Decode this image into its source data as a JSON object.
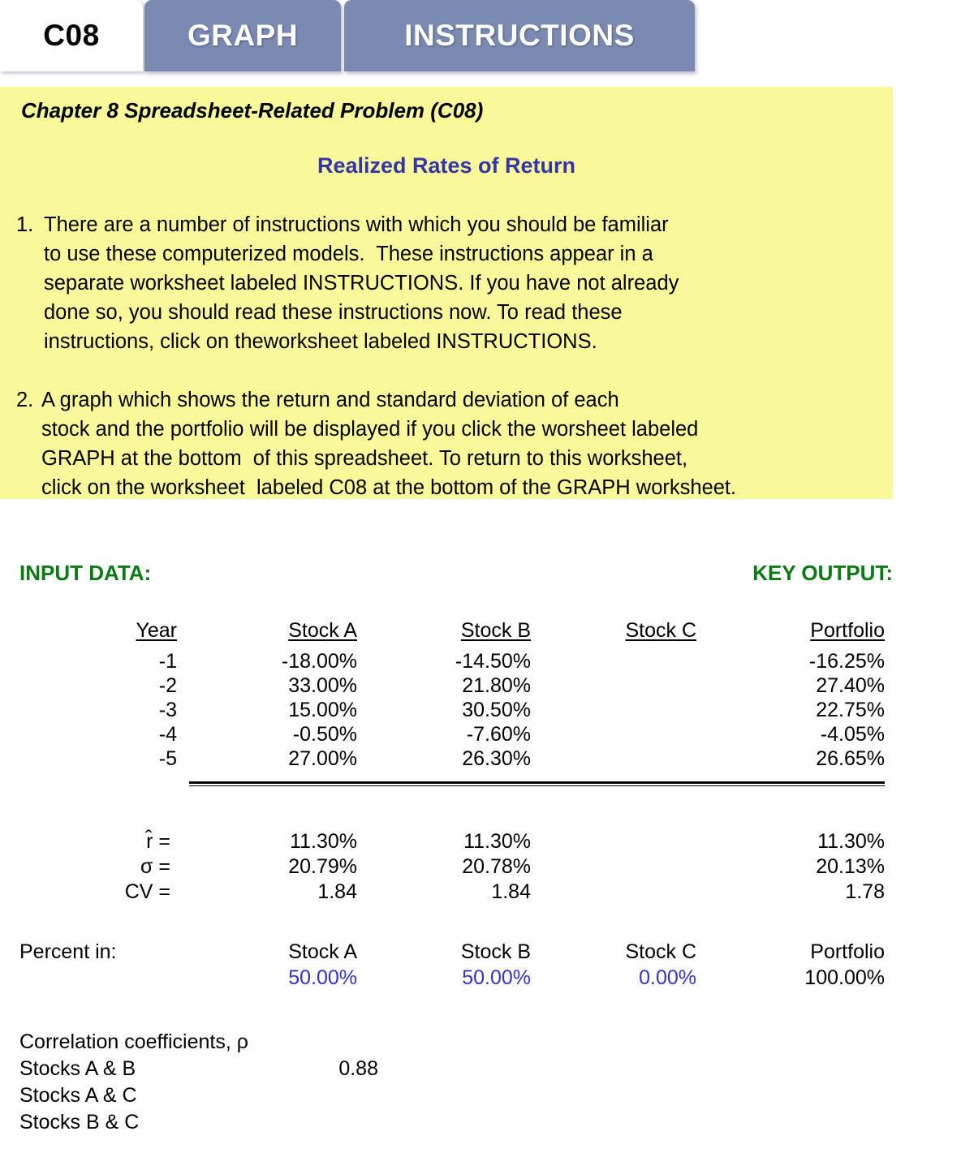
{
  "tabs": [
    {
      "label": "C08",
      "active": true
    },
    {
      "label": "GRAPH",
      "active": false
    },
    {
      "label": "INSTRUCTIONS",
      "active": false
    }
  ],
  "panel": {
    "title": "Chapter 8 Spreadsheet-Related Problem  (C08)",
    "subtitle": "Realized Rates of Return",
    "subtitle_color": "#3434ab",
    "background_color": "#f9f99a",
    "paragraphs": [
      {
        "number": "1.",
        "lines": [
          "There are a number of instructions with which you should be familiar",
          "to use these computerized models.  These instructions appear in a",
          "separate worksheet labeled INSTRUCTIONS. If you have not already",
          "done so, you should read these instructions now. To read these",
          "instructions, click on theworksheet labeled INSTRUCTIONS."
        ]
      },
      {
        "number": "2.",
        "lines": [
          "A graph which shows the return and standard deviation of each",
          "stock and the portfolio will be displayed if you click the worsheet labeled",
          "GRAPH at the bottom  of this spreadsheet. To return to this worksheet,",
          "click on the worksheet  labeled C08 at the bottom of the GRAPH worksheet."
        ]
      }
    ]
  },
  "headings": {
    "input": "INPUT DATA:",
    "output": "KEY OUTPUT:",
    "color": "#0a7a12"
  },
  "table": {
    "columns": [
      "Year",
      "Stock A",
      "Stock B",
      "Stock C",
      "Portfolio"
    ],
    "rows": [
      {
        "year": "-1",
        "a": "-18.00%",
        "b": "-14.50%",
        "c": "",
        "portfolio": "-16.25%"
      },
      {
        "year": "-2",
        "a": "33.00%",
        "b": "21.80%",
        "c": "",
        "portfolio": "27.40%"
      },
      {
        "year": "-3",
        "a": "15.00%",
        "b": "30.50%",
        "c": "",
        "portfolio": "22.75%"
      },
      {
        "year": "-4",
        "a": "-0.50%",
        "b": "-7.60%",
        "c": "",
        "portfolio": "-4.05%"
      },
      {
        "year": "-5",
        "a": "27.00%",
        "b": "26.30%",
        "c": "",
        "portfolio": "26.65%"
      }
    ]
  },
  "stats": {
    "rows": [
      {
        "label": "r̂ =",
        "a": "11.30%",
        "b": "11.30%",
        "c": "",
        "portfolio": "11.30%"
      },
      {
        "label": "σ =",
        "a": "20.79%",
        "b": "20.78%",
        "c": "",
        "portfolio": "20.13%"
      },
      {
        "label": "CV =",
        "a": "1.84",
        "b": "1.84",
        "c": "",
        "portfolio": "1.78"
      }
    ]
  },
  "percent_in": {
    "caption": "Percent in:",
    "columns": [
      "Stock A",
      "Stock B",
      "Stock C",
      "Portfolio"
    ],
    "values": [
      "50.00%",
      "50.00%",
      "0.00%",
      "100.00%"
    ],
    "input_color": "#3333cc"
  },
  "correlations": {
    "heading": "Correlation coefficients, ρ",
    "rows": [
      {
        "label": "Stocks A & B",
        "value": "0.88"
      },
      {
        "label": "Stocks A & C",
        "value": ""
      },
      {
        "label": "Stocks B & C",
        "value": ""
      }
    ]
  }
}
